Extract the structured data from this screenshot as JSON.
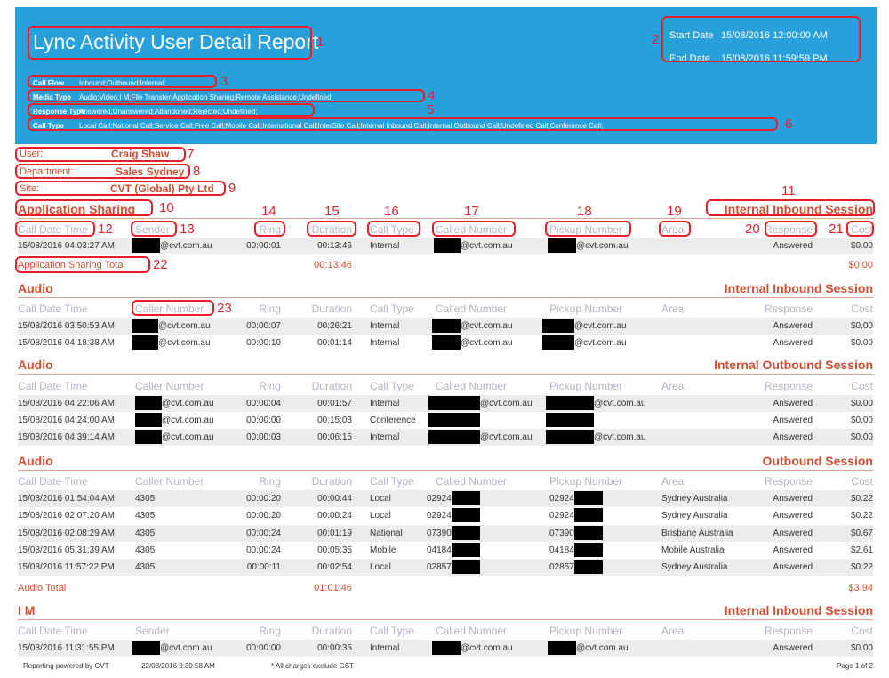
{
  "report": {
    "title": "Lync Activity User Detail Report",
    "start_label": "Start Date",
    "start_value": "15/08/2016 12:00:00 AM",
    "end_label": "End Date",
    "end_value": "15/08/2016 11:59:59 PM"
  },
  "filters": [
    {
      "key": "Call Flow",
      "value": "Inbound;Outbound;Internal;"
    },
    {
      "key": "Media Type",
      "value": "Audio;Video;I M;File Transfer;Application Sharing;Remote Assistance;Undefined;"
    },
    {
      "key": "Response Type",
      "value": "Answered;Unanswered;Abandoned;Rejected;Undefined;"
    },
    {
      "key": "Call Type",
      "value": "Local Call;National Call;Service Call;Free Call;Mobile Call;International Call;InterSite Call;Internal Inbound Call;Internal Outbound Call;Undefined Call;Conference Call;"
    }
  ],
  "user": {
    "label": "User:",
    "value": "Craig Shaw"
  },
  "department": {
    "label": "Department:",
    "value": "Sales Sydney"
  },
  "site": {
    "label": "Site:",
    "value": "CVT (Global) Pty Ltd"
  },
  "columns": {
    "date": "Call Date Time",
    "sender": "Sender",
    "caller": "Caller Number",
    "ring": "Ring",
    "duration": "Duration",
    "calltype": "Call Type",
    "called": "Called Number",
    "pickup": "Pickup Number",
    "area": "Area",
    "response": "Response",
    "cost": "Cost"
  },
  "annotations": [
    "1",
    "2",
    "3",
    "4",
    "5",
    "6",
    "7",
    "8",
    "9",
    "10",
    "11",
    "12",
    "13",
    "14",
    "15",
    "16",
    "17",
    "18",
    "19",
    "20",
    "21",
    "22",
    "23"
  ],
  "sections": [
    {
      "media": "Application Sharing",
      "session": "Internal Inbound Session",
      "rows": [
        {
          "date": "15/08/2016 04:03:27 AM",
          "from": "@cvt.com.au",
          "ring": "00:00:01",
          "duration": "00:13:46",
          "type": "Internal",
          "called": "@cvt.com.au",
          "pickup": "@cvt.com.au",
          "area": "",
          "response": "Answered",
          "cost": "$0.00"
        }
      ],
      "total_label": "Application Sharing Total",
      "total_duration": "00:13:46",
      "total_cost": "$0.00"
    },
    {
      "media": "Audio",
      "session": "Internal Inbound Session",
      "rows": [
        {
          "date": "15/08/2016 03:50:53 AM",
          "from": "@cvt.com.au",
          "ring": "00:00:07",
          "duration": "00:26:21",
          "type": "Internal",
          "called": "@cvt.com.au",
          "pickup": "@cvt.com.au",
          "area": "",
          "response": "Answered",
          "cost": "$0.00"
        },
        {
          "date": "15/08/2016 04:18:38 AM",
          "from": "@cvt.com.au",
          "ring": "00:00:10",
          "duration": "00:01:14",
          "type": "Internal",
          "called": "@cvt.com.au",
          "pickup": "@cvt.com.au",
          "area": "",
          "response": "Answered",
          "cost": "$0.00"
        }
      ]
    },
    {
      "media": "Audio",
      "session": "Internal Outbound Session",
      "rows": [
        {
          "date": "15/08/2016 04:22:06 AM",
          "from": "@cvt.com.au",
          "ring": "00:00:04",
          "duration": "00:01:57",
          "type": "Internal",
          "called": "@cvt.com.au",
          "pickup": "@cvt.com.au",
          "area": "",
          "response": "Answered",
          "cost": "$0.00"
        },
        {
          "date": "15/08/2016 04:24:00 AM",
          "from": "@cvt.com.au",
          "ring": "00:00:00",
          "duration": "00:15:03",
          "type": "Conference",
          "called": "",
          "pickup": "",
          "area": "",
          "response": "Answered",
          "cost": "$0.00"
        },
        {
          "date": "15/08/2016 04:39:14 AM",
          "from": "@cvt.com.au",
          "ring": "00:00:03",
          "duration": "00:06:15",
          "type": "Internal",
          "called": "@cvt.com.au",
          "pickup": "@cvt.com.au",
          "area": "",
          "response": "Answered",
          "cost": "$0.00"
        }
      ]
    },
    {
      "media": "Audio",
      "session": "Outbound Session",
      "rows": [
        {
          "date": "15/08/2016 01:54:04 AM",
          "from": "4305",
          "ring": "00:00:20",
          "duration": "00:00:44",
          "type": "Local",
          "called": "02924",
          "pickup": "02924",
          "area": "Sydney Australia",
          "response": "Answered",
          "cost": "$0.22"
        },
        {
          "date": "15/08/2016 02:07:20 AM",
          "from": "4305",
          "ring": "00:00:20",
          "duration": "00:00:24",
          "type": "Local",
          "called": "02924",
          "pickup": "02924",
          "area": "Sydney Australia",
          "response": "Answered",
          "cost": "$0.22"
        },
        {
          "date": "15/08/2016 02:08:29 AM",
          "from": "4305",
          "ring": "00:00:24",
          "duration": "00:01:19",
          "type": "National",
          "called": "07390",
          "pickup": "07390",
          "area": "Brisbane Australia",
          "response": "Answered",
          "cost": "$0.67"
        },
        {
          "date": "15/08/2016 05:31:39 AM",
          "from": "4305",
          "ring": "00:00:24",
          "duration": "00:05:35",
          "type": "Mobile",
          "called": "04184",
          "pickup": "04184",
          "area": "Mobile Australia",
          "response": "Answered",
          "cost": "$2.61"
        },
        {
          "date": "15/08/2016 11:57:22 PM",
          "from": "4305",
          "ring": "00:00:11",
          "duration": "00:02:54",
          "type": "Local",
          "called": "02857",
          "pickup": "02857",
          "area": "Sydney Australia",
          "response": "Answered",
          "cost": "$0.22"
        }
      ],
      "total_label": "Audio Total",
      "total_duration": "01:01:46",
      "total_cost": "$3.94"
    },
    {
      "media": "I M",
      "session": "Internal Inbound Session",
      "rows": [
        {
          "date": "15/08/2016 11:31:55 PM",
          "from": "@cvt.com.au",
          "ring": "00:00:00",
          "duration": "00:00:35",
          "type": "Internal",
          "called": "@cvt.com.au",
          "pickup": "@cvt.com.au",
          "area": "",
          "response": "Answered",
          "cost": "$0.00"
        }
      ]
    }
  ],
  "footer": {
    "powered": "Reporting powered by CVT",
    "generated": "22/08/2016 9:39:58 AM",
    "note": "* All charges exclude GST",
    "page": "Page 1 of 2"
  },
  "colors": {
    "header_bg": "#27a0db",
    "accent": "#d24d30",
    "annotation": "#e4202a",
    "redaction": "#000000"
  }
}
